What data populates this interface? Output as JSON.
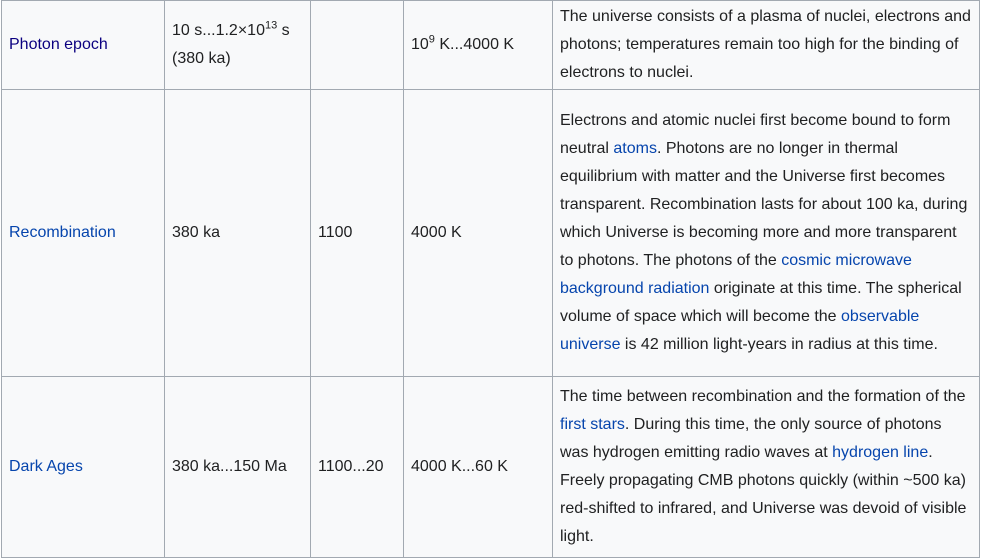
{
  "rows": [
    {
      "epoch": "Photon epoch",
      "time_a": "10 s...1.2×10",
      "time_sup": "13",
      "time_b": " s",
      "time_c": "(380 ka)",
      "redshift": "",
      "temp_a": "10",
      "temp_sup": "9",
      "temp_b": " K...4000 K",
      "desc": "The universe consists of a plasma of nuclei, electrons and photons; temperatures remain too high for the binding of electrons to nuclei."
    },
    {
      "epoch": "Recombination",
      "time": "380 ka",
      "redshift": "1100",
      "temp": "4000 K",
      "desc_1": "Electrons and atomic nuclei first become bound to form neutral ",
      "link_atoms": "atoms",
      "desc_2": ". Photons are no longer in thermal equilibrium with matter and the Universe first becomes transparent. Recombination lasts for about 100 ka, during which Universe is becoming more and more transparent to photons. The photons of the ",
      "link_cmb": "cosmic microwave background radiation",
      "desc_3": " originate at this time. The spherical volume of space which will become the ",
      "link_obs": "observable universe",
      "desc_4": " is 42 million light-years in radius at this time."
    },
    {
      "epoch": "Dark Ages",
      "time": "380 ka...150 Ma",
      "redshift": "1100...20",
      "temp": "4000 K...60 K",
      "desc_1": "The time between recombination and the formation of the ",
      "link_stars": "first stars",
      "desc_2": ". During this time, the only source of photons was hydrogen emitting radio waves at ",
      "link_hline": "hydrogen line",
      "desc_3": ". Freely propagating CMB photons quickly (within ~500 ka) red-shifted to infrared, and Universe was devoid of visible light."
    }
  ]
}
